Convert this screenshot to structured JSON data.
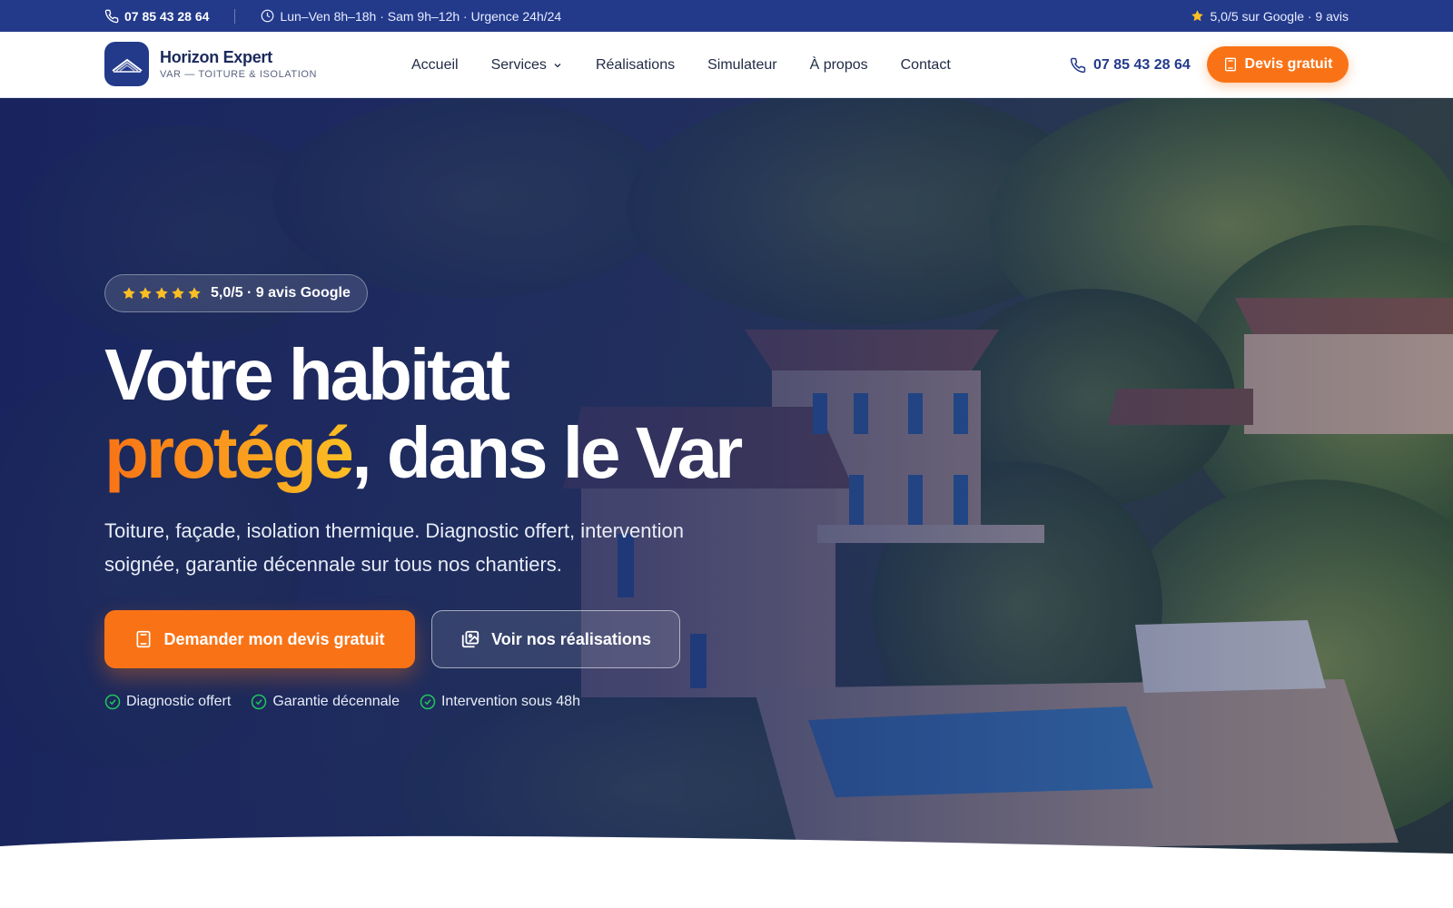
{
  "topbar": {
    "phone": "07 85 43 28 64",
    "hours": "Lun–Ven 8h–18h · Sam 9h–12h · Urgence 24h/24",
    "rating": "5,0/5 sur Google · 9 avis"
  },
  "brand": {
    "name": "Horizon Expert",
    "tagline": "VAR — TOITURE & ISOLATION"
  },
  "nav": {
    "items": [
      {
        "label": "Accueil"
      },
      {
        "label": "Services",
        "has_dropdown": true
      },
      {
        "label": "Réalisations"
      },
      {
        "label": "Simulateur"
      },
      {
        "label": "À propos"
      },
      {
        "label": "Contact"
      }
    ],
    "phone": "07 85 43 28 64",
    "cta_label": "Devis gratuit"
  },
  "hero": {
    "rating_badge": "5,0/5 · 9 avis Google",
    "stars": 5,
    "headline_line1": "Votre habitat",
    "headline_accent": "protégé",
    "headline_rest": ", dans le Var",
    "subtitle": "Toiture, façade, isolation thermique. Diagnostic offert, intervention soignée, garantie décennale sur tous nos chantiers.",
    "primary_cta": "Demander mon devis gratuit",
    "secondary_cta": "Voir nos réalisations",
    "checks": [
      "Diagnostic offert",
      "Garantie décennale",
      "Intervention sous 48h"
    ]
  },
  "colors": {
    "brand_blue": "#233a8b",
    "accent_orange": "#f97316",
    "accent_yellow": "#fbbf24",
    "check_green": "#22c55e"
  },
  "icons": [
    "phone-icon",
    "clock-icon",
    "star-icon",
    "logo-roof-icon",
    "chevron-down-icon",
    "calculator-icon",
    "gallery-icon",
    "check-circle-icon"
  ]
}
